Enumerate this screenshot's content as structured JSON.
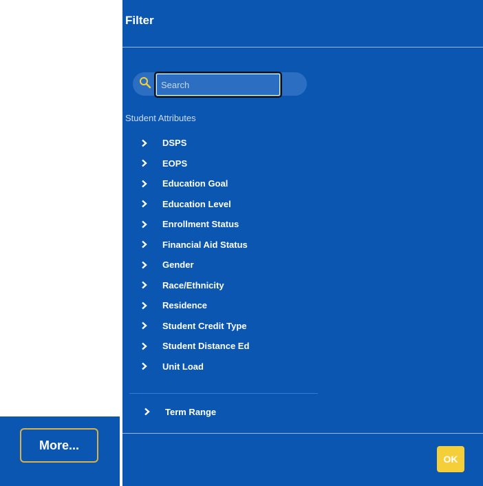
{
  "more": {
    "label": "More..."
  },
  "filter": {
    "title": "Filter",
    "search": {
      "placeholder": "Search",
      "value": ""
    },
    "section_label": "Student Attributes",
    "attributes": [
      "DSPS",
      "EOPS",
      "Education Goal",
      "Education Level",
      "Enrollment Status",
      "Financial Aid Status",
      "Gender",
      "Race/Ethnicity",
      "Residence",
      "Student Credit Type",
      "Student Distance Ed",
      "Unit Load"
    ],
    "term_range": "Term Range",
    "ok_label": "OK"
  },
  "colors": {
    "panel_blue": "#0a56b0",
    "accent_gold": "#f5cf3a",
    "button_border": "#d9b24a"
  },
  "icons": {
    "search": "search-icon",
    "expand": "chevron-right-icon"
  }
}
